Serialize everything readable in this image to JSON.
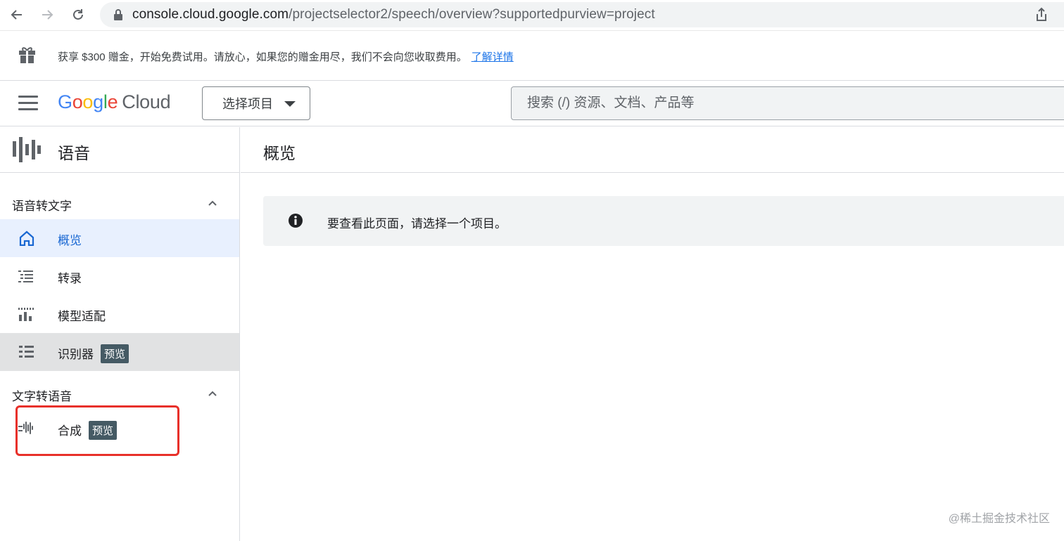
{
  "browser": {
    "url_host": "console.cloud.google.com",
    "url_path": "/projectselector2/speech/overview?supportedpurview=project"
  },
  "promo": {
    "message": "获享 $300 赠金，开始免费试用。请放心，如果您的赠金用尽，我们不会向您收取费用。",
    "link": "了解详情"
  },
  "appbar": {
    "logo_google": "Google",
    "logo_cloud": "Cloud",
    "project_selector": "选择项目",
    "search_placeholder": "搜索 (/) 资源、文档、产品等"
  },
  "sidebar": {
    "product_title": "语音",
    "sections": [
      {
        "title": "语音转文字",
        "items": [
          {
            "label": "概览",
            "icon": "home-icon",
            "state": "active"
          },
          {
            "label": "转录",
            "icon": "list-icon"
          },
          {
            "label": "模型适配",
            "icon": "bars-icon"
          },
          {
            "label": "识别器",
            "icon": "lines-icon",
            "badge": "预览",
            "state": "hovered"
          }
        ]
      },
      {
        "title": "文字转语音",
        "items": [
          {
            "label": "合成",
            "icon": "waveform-icon",
            "badge": "预览"
          }
        ]
      }
    ]
  },
  "main": {
    "title": "概览",
    "info_message": "要查看此页面，请选择一个项目。"
  },
  "watermark": "@稀土掘金技术社区",
  "colors": {
    "accent": "#1a73e8",
    "active_bg": "#e8f0fe",
    "badge_bg": "#455a64",
    "highlight": "#e8302a"
  }
}
